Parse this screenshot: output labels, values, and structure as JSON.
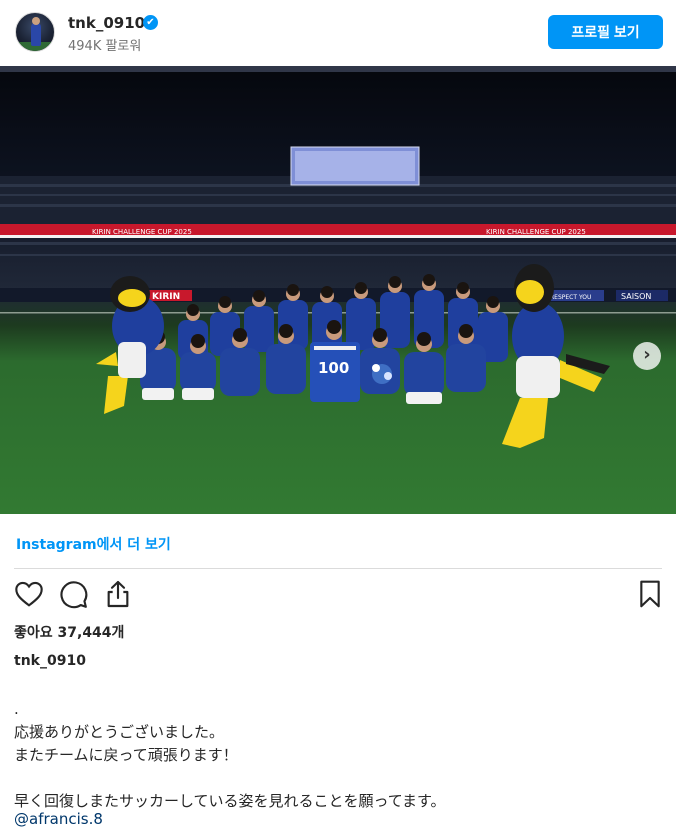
{
  "header": {
    "username": "tnk_0910",
    "verified_mark": "✔",
    "followers": "494K 팔로워",
    "profile_button": "프로필 보기"
  },
  "photo": {
    "stadium_banner_text": "KIRIN CHALLENGE CUP 2025",
    "ad_board_left": "KIRIN",
    "ad_board_right": "SAISON",
    "ad_board_right2": "RESPECT YOU",
    "jersey_number": "100",
    "carousel_dots": 2,
    "active_dot": 0
  },
  "more_link": "Instagram에서 더 보기",
  "icons": {
    "like": "heart-icon",
    "comment": "comment-icon",
    "share": "share-icon",
    "save": "bookmark-icon"
  },
  "likes": "좋아요 37,444개",
  "caption": {
    "username": "tnk_0910",
    "text": ".\n応援ありがとうございました。\nまたチームに戻って頑張ります！\n\n早く回復しまたサッカーしている姿を見れることを願ってます。",
    "mention": "@afrancis.8"
  },
  "colors": {
    "accent": "#0095f6",
    "link": "#00376b",
    "jersey": "#1f3f9e",
    "mascot_yellow": "#f5d41c"
  }
}
